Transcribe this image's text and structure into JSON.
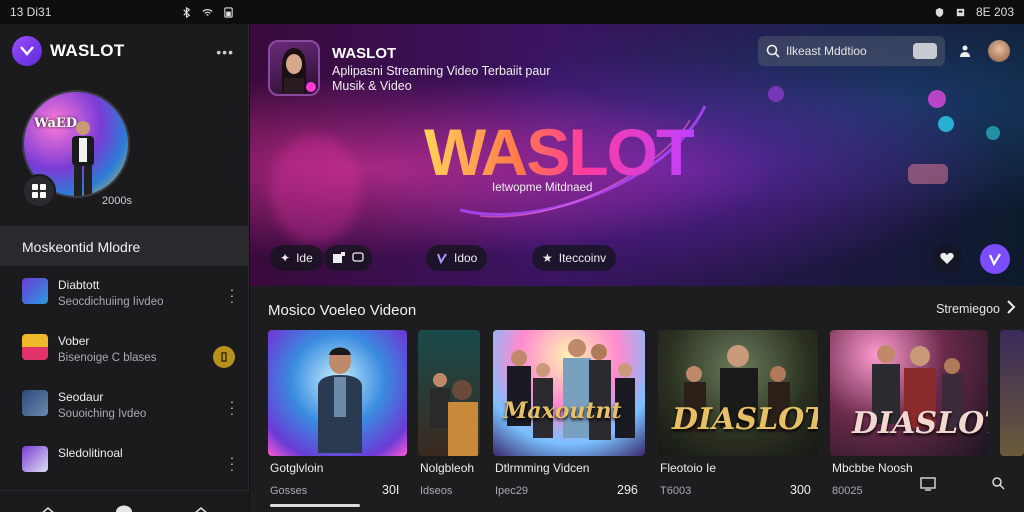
{
  "status_bar": {
    "time": "13 Di31",
    "clock": "8E 203"
  },
  "sidebar": {
    "brand": "WASLOT",
    "avatar_text": "WaED",
    "avatar_count": "2000s",
    "section_title": "Moskeontid Mlodre",
    "items": [
      {
        "title": "Diabtott",
        "subtitle": "Seocdichuiing Iivdeo",
        "action": "more"
      },
      {
        "title": "Vober",
        "subtitle": "Bisenoige C blases",
        "action": "coin"
      },
      {
        "title": "Seodaur",
        "subtitle": "Souoiching Ivdeo",
        "action": "more"
      },
      {
        "title": "Sledolitinoal",
        "subtitle": "",
        "action": "more"
      }
    ],
    "bottom_nav": [
      "home",
      "chat",
      "house"
    ]
  },
  "hero": {
    "title": "WASLOT",
    "subtitle": "Aplipasni Streaming Video Terbaiit paur Musik & Video",
    "logo": "WASLOT",
    "tagline": "Ietwopme Mitdnaed",
    "search_placeholder": "Ilkeast Mddtioo",
    "chips": [
      {
        "label": "Ide",
        "icon": "spark-icon"
      },
      {
        "label": "",
        "icon": "box-icon"
      },
      {
        "label": "Idoo",
        "icon": "play-icon"
      },
      {
        "label": "Iteccoinv",
        "icon": "star-icon"
      }
    ],
    "accent": "#7b4dff"
  },
  "videos": {
    "section_title": "Mosico Voeleo Videon",
    "see_all": "Stremiegoo",
    "cards": [
      {
        "title": "Gotglvloin",
        "meta": "Gosses",
        "count": "30I"
      },
      {
        "title": "Nolgbleoh",
        "meta": "Idseos",
        "count": ""
      },
      {
        "title": "Dtlrmming Vidcen",
        "meta": "Ipec29",
        "count": "296",
        "overlay": "Maxoutnt"
      },
      {
        "title": "Fleotoio Ie",
        "meta": "T6003",
        "count": "300",
        "overlay": "DIASLOT"
      },
      {
        "title": "Mbcbbe Noosh",
        "meta": "80025",
        "count": "",
        "overlay": "DIASLOT"
      },
      {
        "title": "",
        "meta": "",
        "count": ""
      }
    ]
  }
}
